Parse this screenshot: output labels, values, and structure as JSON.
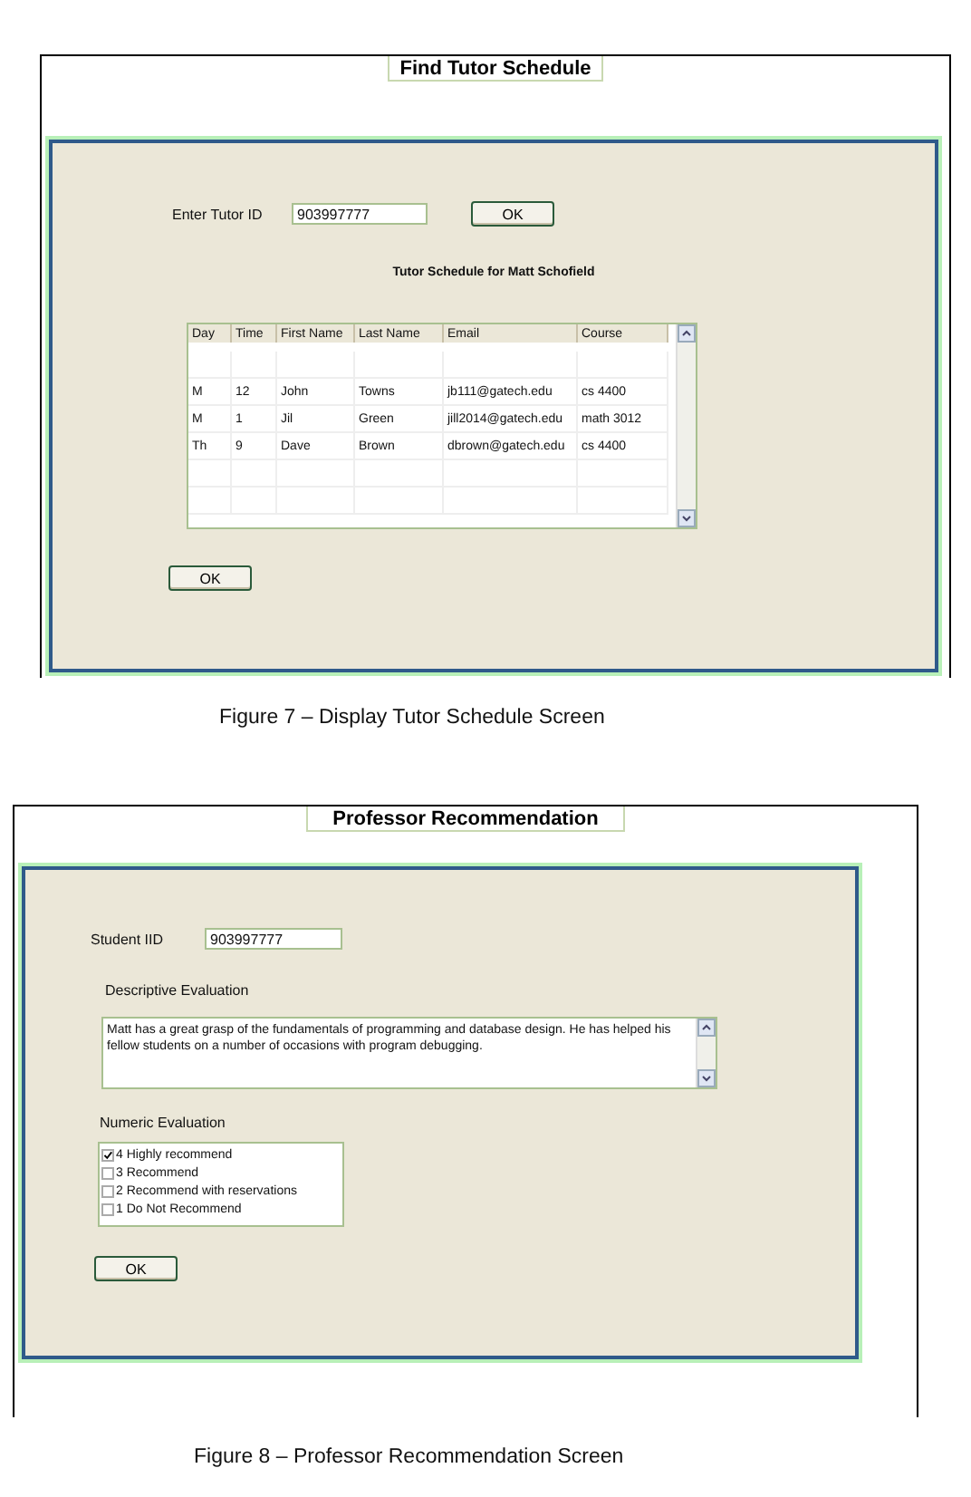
{
  "figures": [
    {
      "kind": "schedule",
      "title": "Find Tutor Schedule",
      "id_label": "Enter Tutor ID",
      "id_value": "903997777",
      "search_button": "OK",
      "table_title": "Tutor Schedule for Matt Schofield",
      "columns": [
        "Day",
        "Time",
        "First Name",
        "Last Name",
        "Email",
        "Course"
      ],
      "rows": [
        [
          "M",
          "12",
          "John",
          "Towns",
          "jb111@gatech.edu",
          "cs 4400"
        ],
        [
          "M",
          "1",
          "Jil",
          "Green",
          "jill2014@gatech.edu",
          "math 3012"
        ],
        [
          "Th",
          "9",
          "Dave",
          "Brown",
          "dbrown@gatech.edu",
          "cs 4400"
        ]
      ],
      "ok_button": "OK",
      "caption": "Figure 7 – Display Tutor Schedule Screen"
    },
    {
      "kind": "recommendation",
      "title": "Professor Recommendation",
      "id_label": "Student  IID",
      "id_value": "903997777",
      "evaluation_label": "Descriptive Evaluation",
      "evaluation_text": "Matt has a great grasp of the fundamentals of programming and database design.  He has helped his fellow students on a number of occasions with program debugging.",
      "numeric_label": "Numeric Evaluation",
      "options": [
        {
          "label": "4 Highly recommend",
          "checked": true
        },
        {
          "label": "3  Recommend",
          "checked": false
        },
        {
          "label": "2 Recommend with reservations",
          "checked": false
        },
        {
          "label": "1 Do  Not Recommend",
          "checked": false
        }
      ],
      "ok_button": "OK",
      "caption": "Figure 8 – Professor Recommendation Screen"
    }
  ]
}
